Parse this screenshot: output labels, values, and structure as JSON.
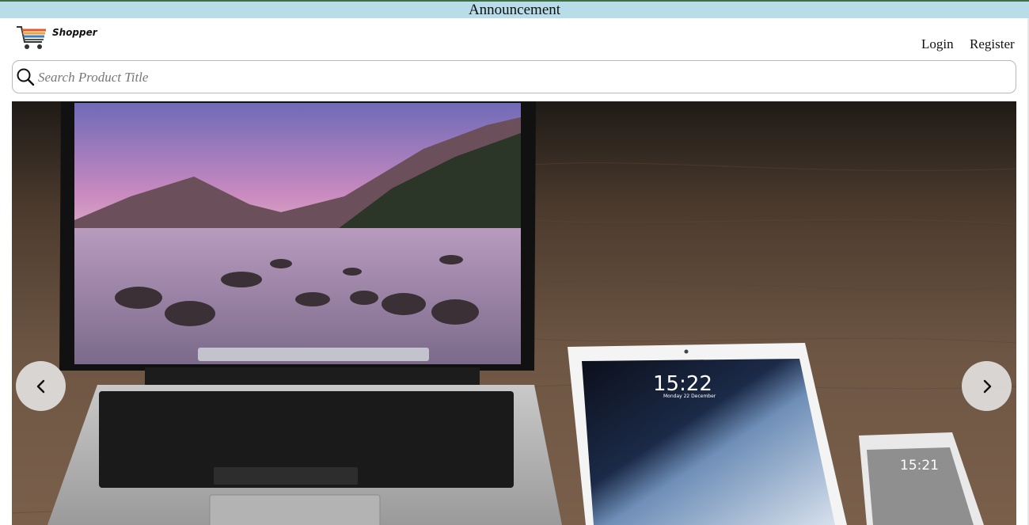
{
  "announcement": {
    "text": "Announcement"
  },
  "brand": {
    "name": "Shopper",
    "icon": "shopping-cart-icon"
  },
  "nav": {
    "login_label": "Login",
    "register_label": "Register"
  },
  "search": {
    "placeholder": "Search Product Title",
    "value": "",
    "icon": "search-icon"
  },
  "carousel": {
    "prev_icon": "chevron-left-icon",
    "next_icon": "chevron-right-icon",
    "slide_image": "laptop-tablet-phone-on-wooden-desk",
    "tablet_time": "15:22",
    "tablet_date": "Monday 22 December",
    "phone_time": "15:21"
  },
  "colors": {
    "announcement_bg": "#b9dde8",
    "announcement_border": "#3f6f45"
  }
}
